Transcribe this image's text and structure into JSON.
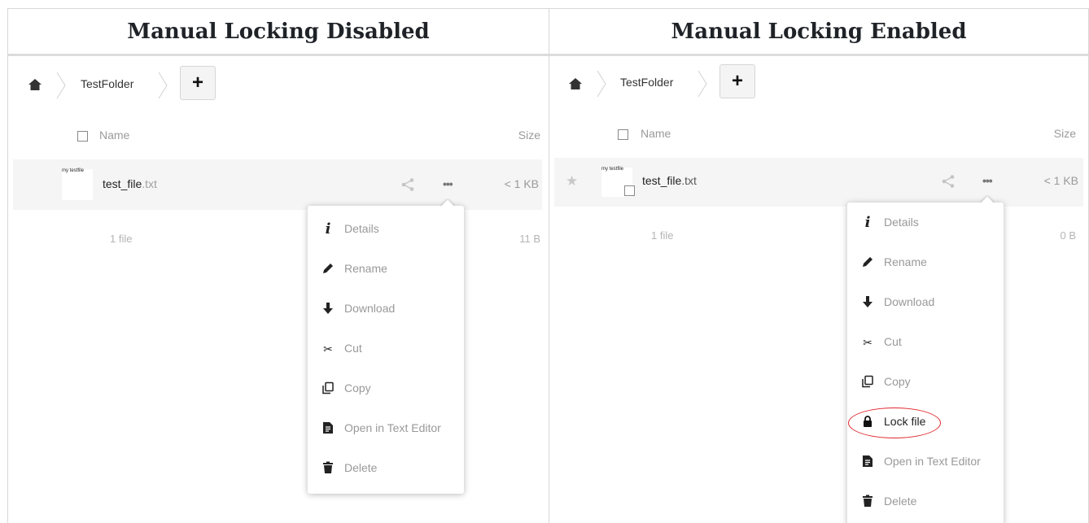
{
  "columns": {
    "left_title": "Manual Locking Disabled",
    "right_title": "Manual Locking Enabled"
  },
  "colors": {
    "lock_highlight": "#e0282e",
    "row_bg": "#f5f5f5",
    "muted_text": "#9a9a9a"
  },
  "left_panel": {
    "breadcrumb": {
      "folder": "TestFolder",
      "add_label": "+"
    },
    "list_header": {
      "name": "Name",
      "size": "Size"
    },
    "file": {
      "thumb_text": "my testfile",
      "name": "test_file",
      "ext": ".txt",
      "size": "< 1 KB"
    },
    "summary": {
      "count": "1 file",
      "size": "11 B"
    },
    "menu": [
      {
        "icon": "info-icon",
        "label": "Details"
      },
      {
        "icon": "pencil-icon",
        "label": "Rename"
      },
      {
        "icon": "download-icon",
        "label": "Download"
      },
      {
        "icon": "scissors-icon",
        "label": "Cut"
      },
      {
        "icon": "copy-icon",
        "label": "Copy"
      },
      {
        "icon": "document-icon",
        "label": "Open in Text Editor"
      },
      {
        "icon": "trash-icon",
        "label": "Delete"
      }
    ]
  },
  "right_panel": {
    "breadcrumb": {
      "folder": "TestFolder",
      "add_label": "+"
    },
    "list_header": {
      "name": "Name",
      "size": "Size"
    },
    "file": {
      "thumb_text": "my testfile",
      "name": "test_file",
      "ext": ".txt",
      "size": "< 1 KB"
    },
    "summary": {
      "count": "1 file",
      "size": "0 B"
    },
    "menu": [
      {
        "icon": "info-icon",
        "label": "Details"
      },
      {
        "icon": "pencil-icon",
        "label": "Rename"
      },
      {
        "icon": "download-icon",
        "label": "Download"
      },
      {
        "icon": "scissors-icon",
        "label": "Cut"
      },
      {
        "icon": "copy-icon",
        "label": "Copy"
      },
      {
        "icon": "lock-icon",
        "label": "Lock file"
      },
      {
        "icon": "document-icon",
        "label": "Open in Text Editor"
      },
      {
        "icon": "trash-icon",
        "label": "Delete"
      }
    ]
  }
}
